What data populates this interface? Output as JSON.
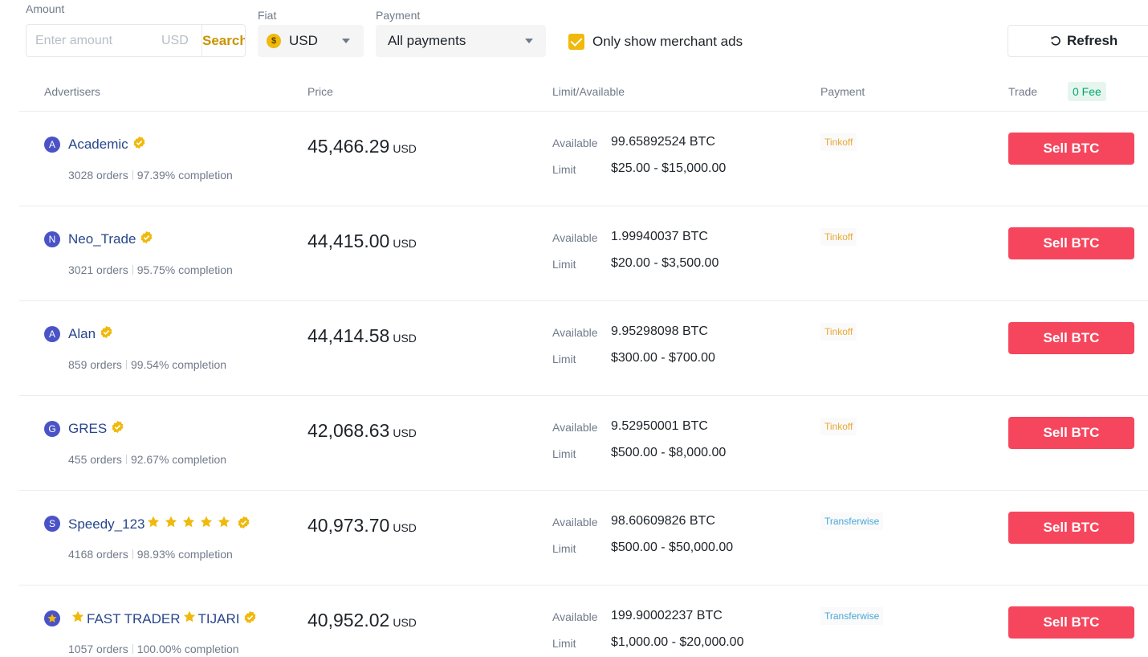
{
  "filters": {
    "amount_label": "Amount",
    "amount_placeholder": "Enter amount",
    "amount_unit": "USD",
    "search_label": "Search",
    "fiat_label": "Fiat",
    "fiat_value": "USD",
    "fiat_icon_glyph": "$",
    "payment_label": "Payment",
    "payment_value": "All payments",
    "merchant_only_label": "Only show merchant ads",
    "merchant_only_checked": true,
    "refresh_label": "Refresh"
  },
  "table": {
    "headers": {
      "advertisers": "Advertisers",
      "price": "Price",
      "limit_available": "Limit/Available",
      "payment": "Payment",
      "trade": "Trade",
      "fee_badge": "0 Fee"
    },
    "available_key": "Available",
    "limit_key": "Limit",
    "rows": [
      {
        "avatar": "A",
        "name": "Academic",
        "stars": 0,
        "orders": "3028 orders",
        "completion": "97.39% completion",
        "price": "45,466.29",
        "price_unit": "USD",
        "available": "99.65892524 BTC",
        "limit": "$25.00 - $15,000.00",
        "payment": "Tinkoff",
        "payment_color": "#e8a935",
        "action": "Sell BTC"
      },
      {
        "avatar": "N",
        "name": "Neo_Trade",
        "stars": 0,
        "orders": "3021 orders",
        "completion": "95.75% completion",
        "price": "44,415.00",
        "price_unit": "USD",
        "available": "1.99940037 BTC",
        "limit": "$20.00 - $3,500.00",
        "payment": "Tinkoff",
        "payment_color": "#e8a935",
        "action": "Sell BTC"
      },
      {
        "avatar": "A",
        "name": "Alan",
        "stars": 0,
        "orders": "859 orders",
        "completion": "99.54% completion",
        "price": "44,414.58",
        "price_unit": "USD",
        "available": "9.95298098 BTC",
        "limit": "$300.00 - $700.00",
        "payment": "Tinkoff",
        "payment_color": "#e8a935",
        "action": "Sell BTC"
      },
      {
        "avatar": "G",
        "name": "GRES",
        "stars": 0,
        "orders": "455 orders",
        "completion": "92.67% completion",
        "price": "42,068.63",
        "price_unit": "USD",
        "available": "9.52950001 BTC",
        "limit": "$500.00 - $8,000.00",
        "payment": "Tinkoff",
        "payment_color": "#e8a935",
        "action": "Sell BTC"
      },
      {
        "avatar": "S",
        "name": "Speedy_123",
        "stars": 5,
        "orders": "4168 orders",
        "completion": "98.93% completion",
        "price": "40,973.70",
        "price_unit": "USD",
        "available": "98.60609826 BTC",
        "limit": "$500.00 - $50,000.00",
        "payment": "Transferwise",
        "payment_color": "#47a8d8",
        "action": "Sell BTC"
      },
      {
        "avatar": "star",
        "name_parts": [
          "FAST TRADER",
          "TIJARI"
        ],
        "stars": 0,
        "orders": "1057 orders",
        "completion": "100.00% completion",
        "price": "40,952.02",
        "price_unit": "USD",
        "available": "199.90002237 BTC",
        "limit": "$1,000.00 - $20,000.00",
        "payment": "Transferwise",
        "payment_color": "#47a8d8",
        "action": "Sell BTC"
      }
    ]
  },
  "colors": {
    "accent": "#f0b90b",
    "sell": "#f6465d",
    "link": "#28468c",
    "muted": "#707a8a"
  }
}
